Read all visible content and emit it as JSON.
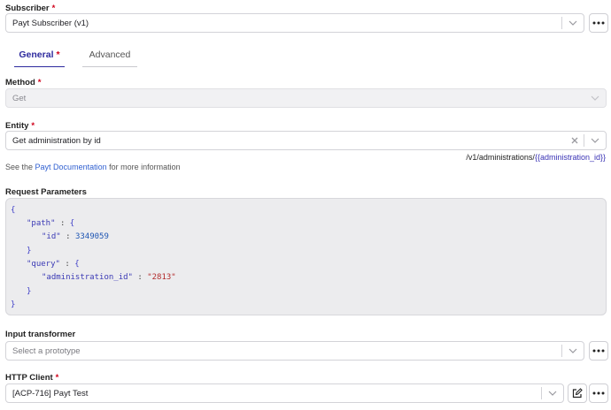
{
  "subscriber": {
    "label": "Subscriber",
    "required_mark": "*",
    "value": "Payt Subscriber (v1)"
  },
  "tabs": [
    {
      "label": "General",
      "required_mark": "*",
      "active": true
    },
    {
      "label": "Advanced",
      "active": false
    }
  ],
  "method": {
    "label": "Method",
    "required_mark": "*",
    "value": "Get"
  },
  "entity": {
    "label": "Entity",
    "required_mark": "*",
    "value": "Get administration by id",
    "path_prefix": "/v1/administrations/",
    "path_variable": "{{administration_id}}"
  },
  "helper": {
    "prefix": "See the",
    "link": "Payt Documentation",
    "suffix": "for more information"
  },
  "request_parameters": {
    "label": "Request Parameters",
    "code": {
      "open_brace": "{",
      "path_key": "\"path\"",
      "id_key": "\"id\"",
      "id_value": "3349059",
      "query_key": "\"query\"",
      "admin_key": "\"administration_id\"",
      "admin_value": "\"2813\"",
      "colon": ":",
      "inner_open": "{",
      "inner_close": "}",
      "close_brace": "}"
    }
  },
  "input_transformer": {
    "label": "Input transformer",
    "placeholder": "Select a prototype"
  },
  "http_client": {
    "label": "HTTP Client",
    "required_mark": "*",
    "value": "[ACP-716] Payt Test"
  }
}
